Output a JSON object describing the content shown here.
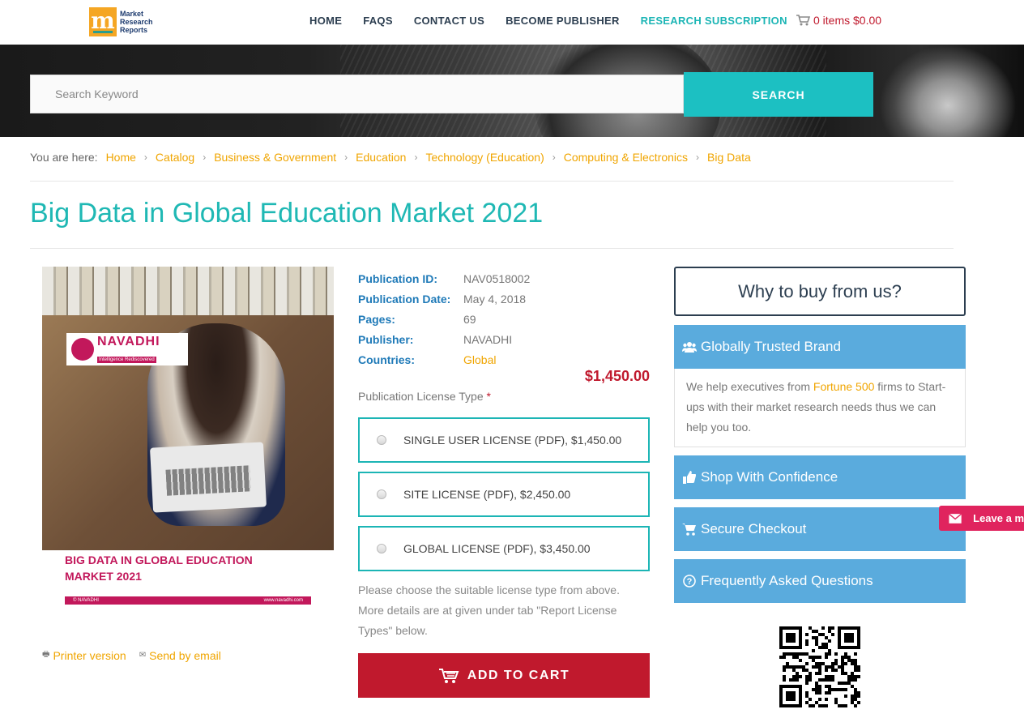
{
  "header": {
    "logo_text": [
      "Market",
      "Research",
      "Reports"
    ],
    "nav": [
      {
        "label": "HOME"
      },
      {
        "label": "FAQS"
      },
      {
        "label": "CONTACT US"
      },
      {
        "label": "BECOME PUBLISHER"
      },
      {
        "label": "RESEARCH SUBSCRIPTION",
        "accent": true
      }
    ],
    "cart_label": "0 items $0.00"
  },
  "search": {
    "placeholder": "Search Keyword",
    "button_label": "SEARCH"
  },
  "breadcrumb": {
    "prefix": "You are here:",
    "items": [
      "Home",
      "Catalog",
      "Business & Government",
      "Education",
      "Technology (Education)",
      "Computing & Electronics",
      "Big Data"
    ]
  },
  "page_title": "Big Data in Global Education Market 2021",
  "cover": {
    "brand": "NAVADHI",
    "tagline": "Intelligence Rediscovered",
    "title_line1": "BIG DATA IN GLOBAL EDUCATION",
    "title_line2": "MARKET 2021",
    "footer_left": "© NAVADHI",
    "footer_right": "www.navadhi.com"
  },
  "links": {
    "printer": "Printer version",
    "email": "Send by email"
  },
  "publication": {
    "id_label": "Publication ID:",
    "id": "NAV0518002",
    "date_label": "Publication Date:",
    "date": "May 4, 2018",
    "pages_label": "Pages:",
    "pages": "69",
    "publisher_label": "Publisher:",
    "publisher": "NAVADHI",
    "countries_label": "Countries:",
    "countries": "Global"
  },
  "price": "$1,450.00",
  "license": {
    "label": "Publication License Type",
    "required_mark": "*",
    "options": [
      "SINGLE USER LICENSE (PDF), $1,450.00",
      "SITE LICENSE (PDF), $2,450.00",
      "GLOBAL LICENSE (PDF), $3,450.00"
    ],
    "help_line1": "Please choose the suitable license type from above.",
    "help_line2": "More details are at given under tab \"Report License",
    "help_line3": "Types\" below."
  },
  "add_to_cart": "ADD TO CART",
  "sidebar": {
    "why_title": "Why to buy from us?",
    "trusted_title": "Globally Trusted Brand",
    "trusted_body_pre": "We help executives from ",
    "trusted_body_hl": "Fortune 500",
    "trusted_body_post": " firms to Start-ups with their market research needs thus we can help you too.",
    "items": [
      "Shop With Confidence",
      "Secure Checkout",
      "Frequently Asked Questions"
    ]
  },
  "leave_message": "Leave a m",
  "colors": {
    "teal": "#1cb5b5",
    "red": "#c0192d",
    "orange": "#f0a500",
    "blue": "#5aabdd",
    "navy": "#2c3e50"
  }
}
